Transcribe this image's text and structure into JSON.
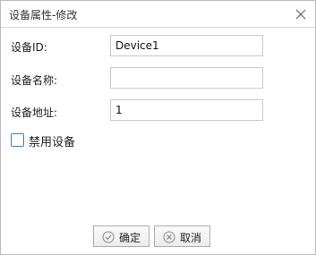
{
  "dialog": {
    "title": "设备属性-修改",
    "close_icon": "close-icon"
  },
  "fields": {
    "device_id": {
      "label": "设备ID:",
      "value": "Device1"
    },
    "device_name": {
      "label": "设备名称:",
      "value": ""
    },
    "device_address": {
      "label": "设备地址:",
      "value": "1"
    }
  },
  "disable_device": {
    "label": "禁用设备",
    "checked": false
  },
  "buttons": {
    "ok": {
      "label": "确定",
      "icon": "check-circle-icon"
    },
    "cancel": {
      "label": "取消",
      "icon": "x-circle-icon"
    }
  },
  "colors": {
    "checkbox_border": "#3a7fd4",
    "icon_gray": "#888888"
  }
}
